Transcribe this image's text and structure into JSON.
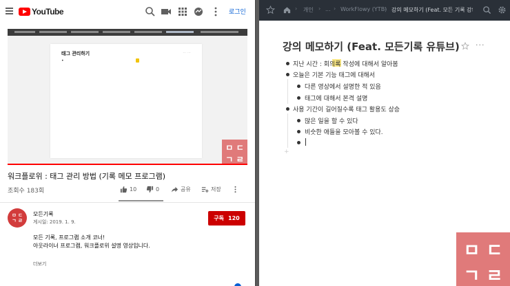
{
  "youtube": {
    "logo_text": "YouTube",
    "login_label": "로그인",
    "video": {
      "frame_title": "태그 관리하기",
      "frame_bullet": "• ",
      "frame_dots": "⋯ ⋯",
      "logo_chars": [
        "ㅁ",
        "ㄷ",
        "ㄱ",
        "ㄹ"
      ]
    },
    "title": "워크플로위 : 태그 관리 방법 (기록 메모 프로그램)",
    "views": "조회수 183회",
    "actions": {
      "likes": "10",
      "dislikes": "0",
      "share": "공유",
      "save": "저장"
    },
    "channel": {
      "avatar_chars": [
        "ㅁ",
        "ㄷ",
        "ㄱ",
        "ㄹ"
      ],
      "name": "모든기록",
      "date": "게시일: 2019. 1. 9.",
      "subscribe_label": "구독",
      "subscribe_count": "120"
    },
    "description": [
      "모든 기록, 프로그램 소개 코너!",
      "아웃라이너 프로그램, 워크플로위 설명 영상입니다."
    ],
    "more_label": "더보기"
  },
  "workflowy": {
    "breadcrumbs": [
      "개인",
      "...",
      "WorkFlowy (YTB)",
      "강의 메모하기 (Feat. 모든 기록 강의"
    ],
    "title": "강의 메모하기 (Feat. 모든기록 유튜브)",
    "items": [
      {
        "text": "지난 시간 : 회의록 작성에 대해서 알아봄",
        "level": 0
      },
      {
        "text": "오늘은 기본 기능 태그에 대해서",
        "level": 0
      },
      {
        "text": "다른 영상에서 설명한 적 있음",
        "level": 1
      },
      {
        "text": "태그에 대해서 본격 설명",
        "level": 1
      },
      {
        "text": "사용 기간이 길어질수록 태그 활용도 상승",
        "level": 0
      },
      {
        "text": "많은 일을 할 수 있다",
        "level": 1
      },
      {
        "text": "비슷한 애들을 모아볼 수 있다.",
        "level": 1
      },
      {
        "text": "",
        "level": 1
      }
    ],
    "add_symbol": "+",
    "logo_chars": [
      "ㅁ",
      "ㄷ",
      "ㄱ",
      "ㄹ"
    ]
  },
  "colors": {
    "youtube_red": "#ff0000",
    "subscribe_red": "#cc0000",
    "workflowy_topbar": "#2a3038",
    "logo_pink": "#e07a7a",
    "highlight_yellow": "#f7e26b"
  }
}
